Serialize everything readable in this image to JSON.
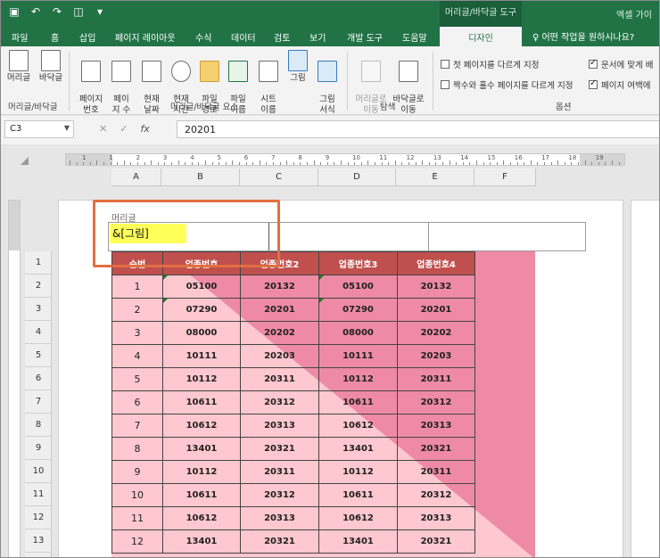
{
  "titlebar": {
    "context_tool": "머리글/바닥글 도구",
    "app_title": "엑셀 가이"
  },
  "tabs": {
    "items": [
      "파일",
      "홈",
      "삽입",
      "페이지 레이아웃",
      "수식",
      "데이터",
      "검토",
      "보기",
      "개발 도구",
      "도움말"
    ],
    "active": "디자인",
    "tell_me": "어떤 작업을 원하시나요?"
  },
  "ribbon": {
    "header_btn": "머리글",
    "footer_btn": "바닥글",
    "group1": "머리글/바닥글",
    "page_num": "페이지\n번호",
    "page_count": "페이\n지 수",
    "cur_date": "현재\n날짜",
    "cur_time": "현재\n시간",
    "file_path": "파일\n경로",
    "file_name": "파일\n이름",
    "sheet_name": "시트\n이름",
    "picture": "그림",
    "format_picture": "그림\n서식",
    "group2": "머리글/바닥글 요소",
    "goto_header": "머리글로\n이동",
    "goto_footer": "바닥글로\n이동",
    "group3": "탐색",
    "opt_first": "첫 페이지를 다르게 지정",
    "opt_oddeven": "짝수와 홀수 페이지를 다르게 지정",
    "opt_scale": "문서에 맞게 배",
    "opt_align": "페이지 여백에",
    "group4": "옵션"
  },
  "formula": {
    "namebox": "C3",
    "cancel": "✕",
    "enter": "✓",
    "fx": "fx",
    "value": "20201"
  },
  "ruler": {
    "numbers": [
      "1",
      "1",
      "2",
      "3",
      "4",
      "5",
      "6",
      "7",
      "8",
      "9",
      "10",
      "11",
      "12",
      "13",
      "14",
      "15",
      "16",
      "17",
      "18",
      "19"
    ]
  },
  "columns": [
    "A",
    "B",
    "C",
    "D",
    "E",
    "F"
  ],
  "rows": [
    "1",
    "2",
    "3",
    "4",
    "5",
    "6",
    "7",
    "8",
    "9",
    "10",
    "11",
    "12",
    "13"
  ],
  "header_area": {
    "label": "머리글",
    "content": "&[그림]"
  },
  "table": {
    "headers": [
      "순번",
      "업종번호",
      "업종번호2",
      "업종번호3",
      "업종번호4"
    ],
    "rows": [
      [
        "1",
        "05100",
        "20132",
        "05100",
        "20132"
      ],
      [
        "2",
        "07290",
        "20201",
        "07290",
        "20201"
      ],
      [
        "3",
        "08000",
        "20202",
        "08000",
        "20202"
      ],
      [
        "4",
        "10111",
        "20203",
        "10111",
        "20203"
      ],
      [
        "5",
        "10112",
        "20311",
        "10112",
        "20311"
      ],
      [
        "6",
        "10611",
        "20312",
        "10611",
        "20312"
      ],
      [
        "7",
        "10612",
        "20313",
        "10612",
        "20313"
      ],
      [
        "8",
        "13401",
        "20321",
        "13401",
        "20321"
      ],
      [
        "9",
        "10112",
        "20311",
        "10112",
        "20311"
      ],
      [
        "10",
        "10611",
        "20312",
        "10611",
        "20312"
      ],
      [
        "11",
        "10612",
        "20313",
        "10612",
        "20313"
      ],
      [
        "12",
        "13401",
        "20321",
        "13401",
        "20321"
      ]
    ]
  },
  "colors": {
    "excel_green": "#217346",
    "table_header": "#c0504d",
    "pink_light": "#ffc7cf",
    "pink_dark": "#ee8aa6",
    "highlight": "#ffff5a",
    "callout": "#e26f42"
  }
}
